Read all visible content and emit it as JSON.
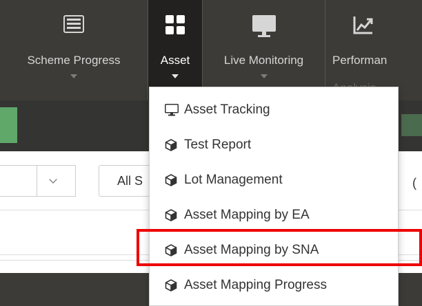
{
  "nav": {
    "items": [
      {
        "label": "Scheme Progress",
        "icon": "list-icon"
      },
      {
        "label": "Asset",
        "icon": "grid-icon"
      },
      {
        "label": "Live Monitoring",
        "icon": "monitor-icon"
      },
      {
        "label": "Performan",
        "sub": "Analysis",
        "icon": "chart-line-icon"
      }
    ]
  },
  "filters": {
    "all_label": "All S",
    "right_char": "("
  },
  "dropdown": {
    "items": [
      {
        "label": "Asset Tracking",
        "icon": "monitor-icon"
      },
      {
        "label": "Test Report",
        "icon": "cube-icon"
      },
      {
        "label": "Lot Management",
        "icon": "cube-icon"
      },
      {
        "label": "Asset Mapping by EA",
        "icon": "cube-icon"
      },
      {
        "label": "Asset Mapping by SNA",
        "icon": "cube-icon"
      },
      {
        "label": "Asset Mapping Progress",
        "icon": "cube-icon"
      }
    ]
  },
  "colors": {
    "highlight": "#ee0000",
    "nav_bg": "#3c3b37",
    "active_bg": "#222120",
    "green": "#5fa86a"
  }
}
